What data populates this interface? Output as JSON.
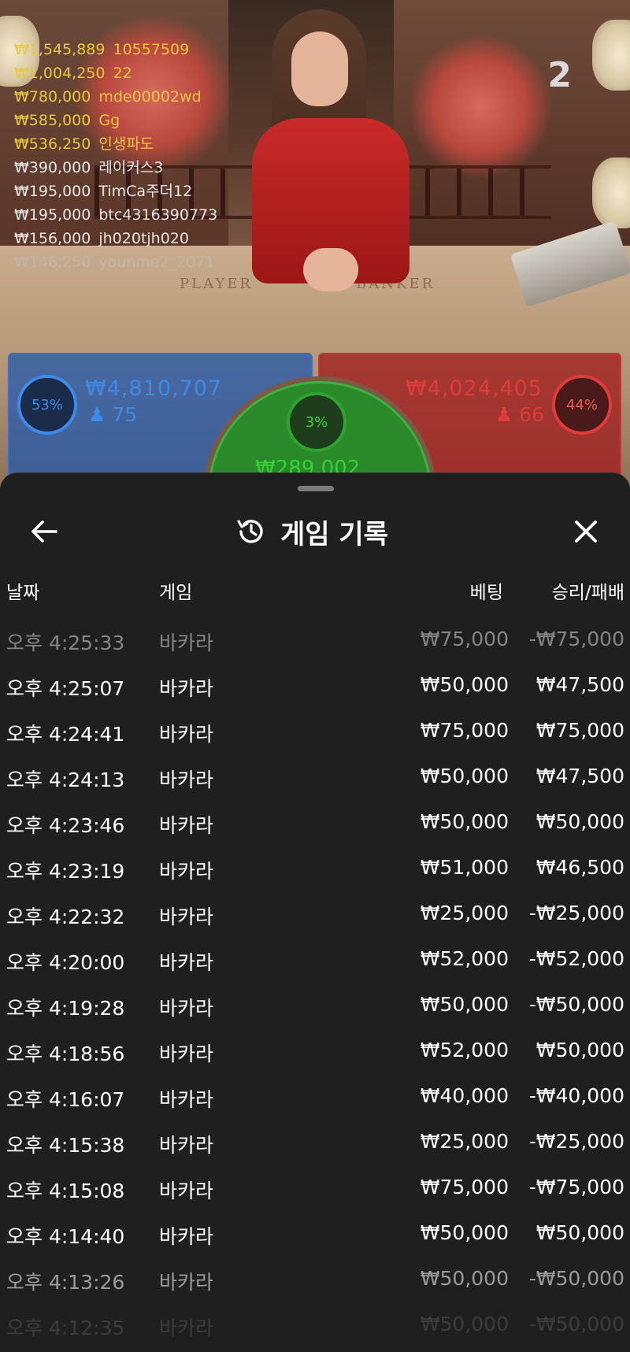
{
  "stream": {
    "round_number": "2",
    "table_labels": {
      "player": "PLAYER",
      "banker": "BANKER"
    }
  },
  "ticker": [
    {
      "amount": "₩1,545,889",
      "user": "10557509",
      "color": "#e8c840"
    },
    {
      "amount": "₩1,004,250",
      "user": "22",
      "color": "#e8c840"
    },
    {
      "amount": "₩780,000",
      "user": "mde00002wd",
      "color": "#e8c840"
    },
    {
      "amount": "₩585,000",
      "user": "Gg",
      "color": "#e8c840"
    },
    {
      "amount": "₩536,250",
      "user": "인생파도",
      "color": "#e8c840"
    },
    {
      "amount": "₩390,000",
      "user": "레이커스3",
      "color": "#e6e6e6"
    },
    {
      "amount": "₩195,000",
      "user": "TimCa주더12",
      "color": "#e6e6e6"
    },
    {
      "amount": "₩195,000",
      "user": "btc4316390773",
      "color": "#e6e6e6"
    },
    {
      "amount": "₩156,000",
      "user": "jh020tjh020",
      "color": "#e6e6e6"
    },
    {
      "amount": "₩146,250",
      "user": "younme2_2071",
      "color": "#bfbfbf"
    }
  ],
  "bets": {
    "player": {
      "percent": "53%",
      "amount": "₩4,810,707",
      "count": "75",
      "color": "#3d8be6"
    },
    "banker": {
      "percent": "44%",
      "amount": "₩4,024,405",
      "count": "66",
      "color": "#e03a3a"
    },
    "tie": {
      "percent": "3%",
      "amount": "₩289,002",
      "color": "#36d136"
    }
  },
  "history": {
    "title": "게임 기록",
    "icons": {
      "back": "arrow-left-icon",
      "title": "history-clock-icon",
      "close": "close-icon"
    },
    "columns": {
      "date": "날짜",
      "game": "게임",
      "bet": "베팅",
      "win_loss": "승리/패배"
    },
    "rows": [
      {
        "time": "오후 4:25:33",
        "game": "바카라",
        "bet": "₩75,000",
        "result": "-₩75,000"
      },
      {
        "time": "오후 4:25:07",
        "game": "바카라",
        "bet": "₩50,000",
        "result": "₩47,500"
      },
      {
        "time": "오후 4:24:41",
        "game": "바카라",
        "bet": "₩75,000",
        "result": "₩75,000"
      },
      {
        "time": "오후 4:24:13",
        "game": "바카라",
        "bet": "₩50,000",
        "result": "₩47,500"
      },
      {
        "time": "오후 4:23:46",
        "game": "바카라",
        "bet": "₩50,000",
        "result": "₩50,000"
      },
      {
        "time": "오후 4:23:19",
        "game": "바카라",
        "bet": "₩51,000",
        "result": "₩46,500"
      },
      {
        "time": "오후 4:22:32",
        "game": "바카라",
        "bet": "₩25,000",
        "result": "-₩25,000"
      },
      {
        "time": "오후 4:20:00",
        "game": "바카라",
        "bet": "₩52,000",
        "result": "-₩52,000"
      },
      {
        "time": "오후 4:19:28",
        "game": "바카라",
        "bet": "₩50,000",
        "result": "-₩50,000"
      },
      {
        "time": "오후 4:18:56",
        "game": "바카라",
        "bet": "₩52,000",
        "result": "₩50,000"
      },
      {
        "time": "오후 4:16:07",
        "game": "바카라",
        "bet": "₩40,000",
        "result": "-₩40,000"
      },
      {
        "time": "오후 4:15:38",
        "game": "바카라",
        "bet": "₩25,000",
        "result": "-₩25,000"
      },
      {
        "time": "오후 4:15:08",
        "game": "바카라",
        "bet": "₩75,000",
        "result": "-₩75,000"
      },
      {
        "time": "오후 4:14:40",
        "game": "바카라",
        "bet": "₩50,000",
        "result": "₩50,000"
      },
      {
        "time": "오후 4:13:26",
        "game": "바카라",
        "bet": "₩50,000",
        "result": "-₩50,000"
      },
      {
        "time": "오후 4:12:35",
        "game": "바카라",
        "bet": "₩50,000",
        "result": "-₩50,000"
      }
    ]
  }
}
